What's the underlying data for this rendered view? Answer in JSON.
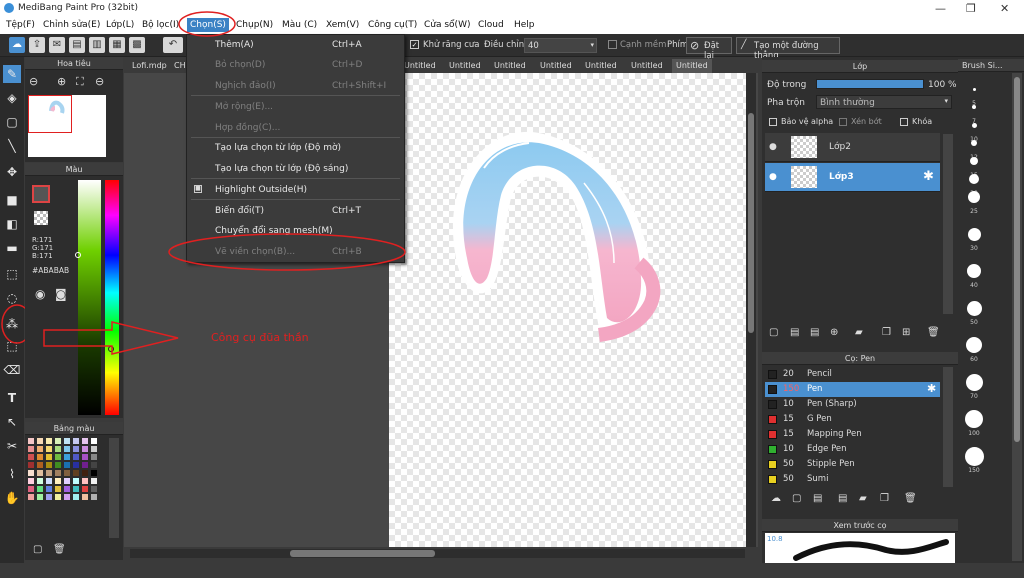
{
  "window": {
    "title": "MediBang Paint Pro (32bit)"
  },
  "menubar": [
    "Tệp(F)",
    "Chỉnh sửa(E)",
    "Lớp(L)",
    "Bộ lọc(I)",
    "Chọn(S)",
    "Chụp(N)",
    "Màu (C)",
    "Xem(V)",
    "Công cụ(T)",
    "Cửa sổ(W)",
    "Cloud",
    "Help"
  ],
  "toolbar": {
    "anti_alias": "Khử răng cưa",
    "adjust": "Điều chỉnh",
    "adjust_value": "40",
    "soft_edge": "Cạnh mềm",
    "key": "Phím",
    "reset": "Đặt lại",
    "create_line": "Tạo một đường thẳng"
  },
  "tabs": [
    "Lofi.mdp",
    "CH",
    "Untitled",
    "Untitled",
    "Untitled",
    "Untitled",
    "Untitled",
    "Untitled",
    "Untitled"
  ],
  "navigator": {
    "title": "Hoa tiêu"
  },
  "color_panel": {
    "title": "Màu",
    "r": "R:171",
    "g": "G:171",
    "b": "B:171",
    "hex": "#ABABAB"
  },
  "palette": {
    "title": "Bảng màu"
  },
  "select_menu": {
    "items": [
      {
        "label": "Thêm(A)",
        "shortcut": "Ctrl+A",
        "enabled": true
      },
      {
        "label": "Bỏ chọn(D)",
        "shortcut": "Ctrl+D",
        "enabled": false
      },
      {
        "label": "Nghịch đảo(I)",
        "shortcut": "Ctrl+Shift+I",
        "enabled": false
      },
      {
        "label": "Mở rộng(E)...",
        "shortcut": "",
        "enabled": false
      },
      {
        "label": "Hợp đồng(C)...",
        "shortcut": "",
        "enabled": false
      },
      {
        "label": "Tạo lựa chọn từ lớp (Độ mờ)",
        "shortcut": "",
        "enabled": true
      },
      {
        "label": "Tạo lựa chọn từ lớp (Độ sáng)",
        "shortcut": "",
        "enabled": true
      },
      {
        "label": "Highlight Outside(H)",
        "shortcut": "",
        "enabled": true
      },
      {
        "label": "Biến đổi(T)",
        "shortcut": "Ctrl+T",
        "enabled": true
      },
      {
        "label": "Chuyển đổi sang mesh(M)",
        "shortcut": "",
        "enabled": true
      },
      {
        "label": "Vẽ viền chọn(B)...",
        "shortcut": "Ctrl+B",
        "enabled": false
      }
    ]
  },
  "annotation": {
    "text": "Công cụ đũa thần"
  },
  "layer_panel": {
    "title": "Lớp",
    "opacity_label": "Độ trong",
    "opacity": "100 %",
    "blend_label": "Pha trộn",
    "blend": "Bình thường",
    "protect_alpha": "Bảo vệ alpha",
    "clip": "Xén bớt",
    "lock": "Khóa",
    "layers": [
      {
        "name": "Lớp2",
        "selected": false
      },
      {
        "name": "Lớp3",
        "selected": true
      }
    ]
  },
  "brush_panel": {
    "title": "Cọ: Pen",
    "brushes": [
      {
        "size": "20",
        "name": "Pencil",
        "color": "#222222",
        "selected": false
      },
      {
        "size": "150",
        "name": "Pen",
        "color": "#222222",
        "selected": true
      },
      {
        "size": "10",
        "name": "Pen (Sharp)",
        "color": "#222222",
        "selected": false
      },
      {
        "size": "15",
        "name": "G Pen",
        "color": "#e03030",
        "selected": false
      },
      {
        "size": "15",
        "name": "Mapping Pen",
        "color": "#e03030",
        "selected": false
      },
      {
        "size": "10",
        "name": "Edge Pen",
        "color": "#30b030",
        "selected": false
      },
      {
        "size": "50",
        "name": "Stipple Pen",
        "color": "#e8d020",
        "selected": false
      },
      {
        "size": "50",
        "name": "Sumi",
        "color": "#e8d020",
        "selected": false
      }
    ]
  },
  "preview": {
    "title": "Xem trước cọ",
    "value": "10.8"
  },
  "brush_size": {
    "title": "Brush Si...",
    "sizes": [
      "5",
      "7",
      "10",
      "12",
      "15",
      "20",
      "25",
      "30",
      "40",
      "50",
      "60",
      "70",
      "100",
      "150"
    ]
  }
}
